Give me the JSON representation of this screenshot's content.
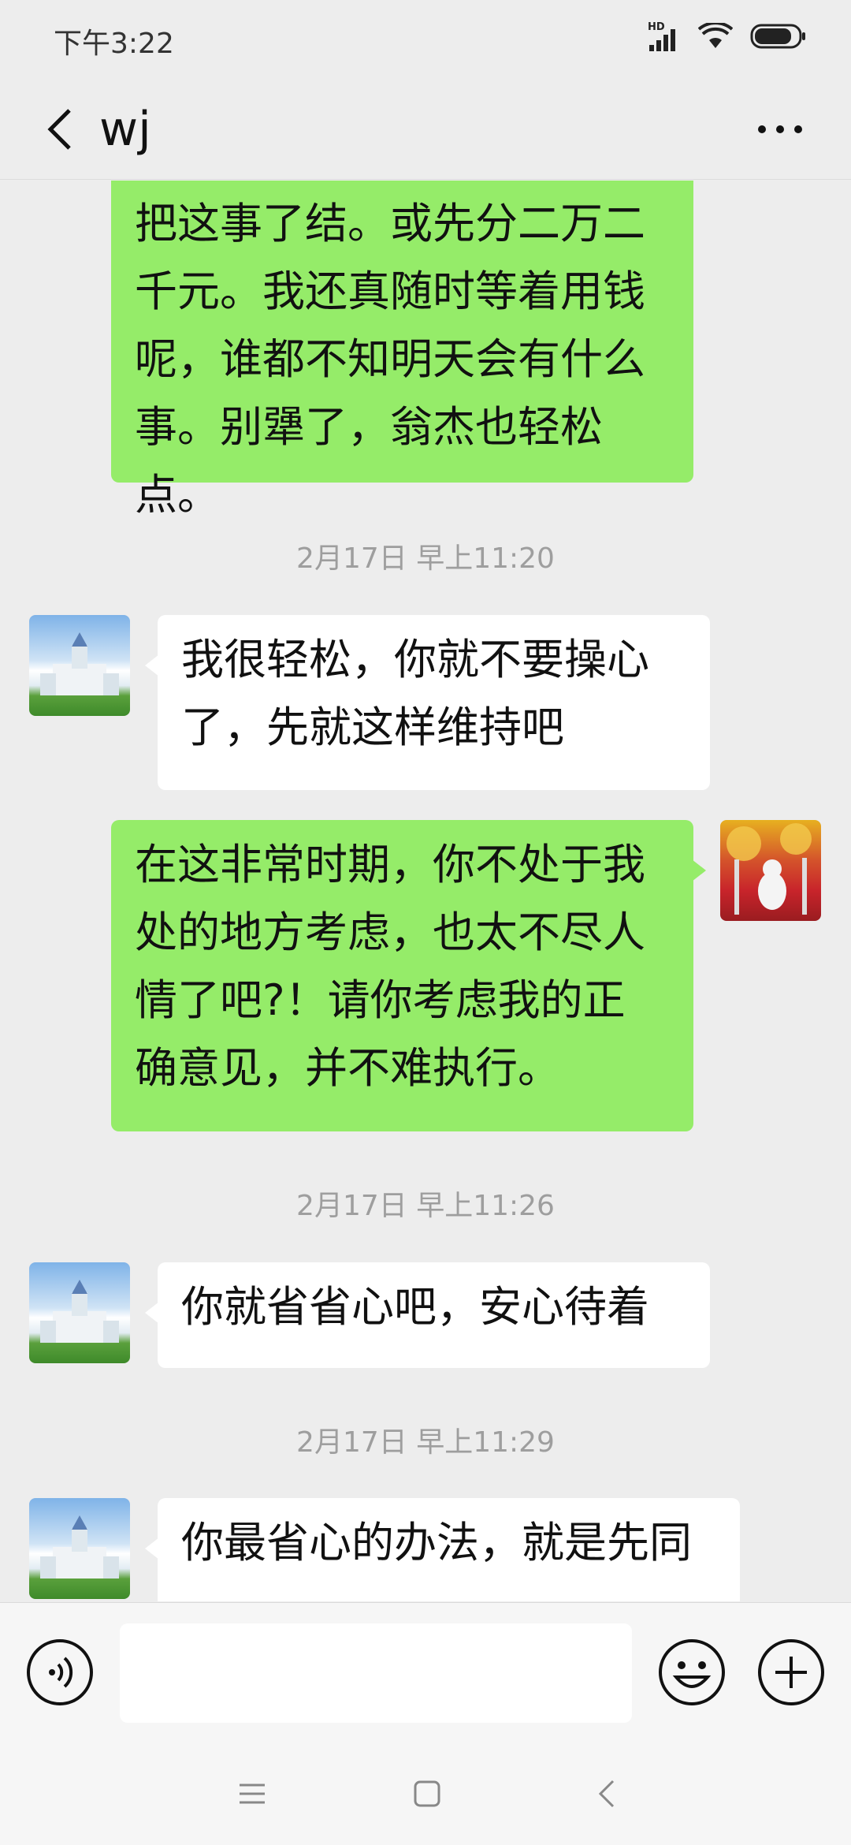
{
  "status_bar": {
    "time": "下午3:22",
    "network_label": "HD",
    "battery_level": 0.85
  },
  "header": {
    "title": "wj",
    "back_icon": "chevron-left-icon",
    "more_icon": "more-horizontal-icon"
  },
  "messages": [
    {
      "type": "sent",
      "lines": [
        "把这事了结。或先分二万二",
        "千元。我还真随时等着用钱",
        "呢，谁都不知明天会有什么",
        "事。别犟了，翁杰也轻松点。"
      ]
    },
    {
      "type": "timestamp",
      "text": "2月17日 早上11:20"
    },
    {
      "type": "received",
      "lines": [
        "我很轻松，你就不要操心",
        "了，先就这样维持吧"
      ]
    },
    {
      "type": "sent",
      "lines": [
        "在这非常时期，你不处于我",
        "处的地方考虑，也太不尽人",
        "情了吧?！请你考虑我的正",
        "确意见，并不难执行。"
      ]
    },
    {
      "type": "timestamp",
      "text": "2月17日 早上11:26"
    },
    {
      "type": "received",
      "lines": [
        "你就省省心吧，安心待着"
      ]
    },
    {
      "type": "timestamp",
      "text": "2月17日 早上11:29"
    },
    {
      "type": "received",
      "lines": [
        "你最省心的办法，就是先同"
      ]
    }
  ],
  "input_bar": {
    "placeholder": "",
    "voice_icon": "voice-icon",
    "emoji_icon": "emoji-icon",
    "plus_icon": "plus-icon"
  },
  "nav_bar": {
    "menu_icon": "menu-icon",
    "home_icon": "home-icon",
    "back_icon": "back-icon"
  },
  "colors": {
    "sent_bubble": "#95ec69",
    "received_bubble": "#ffffff",
    "background": "#ededed",
    "timestamp_text": "#9e9e9e"
  }
}
